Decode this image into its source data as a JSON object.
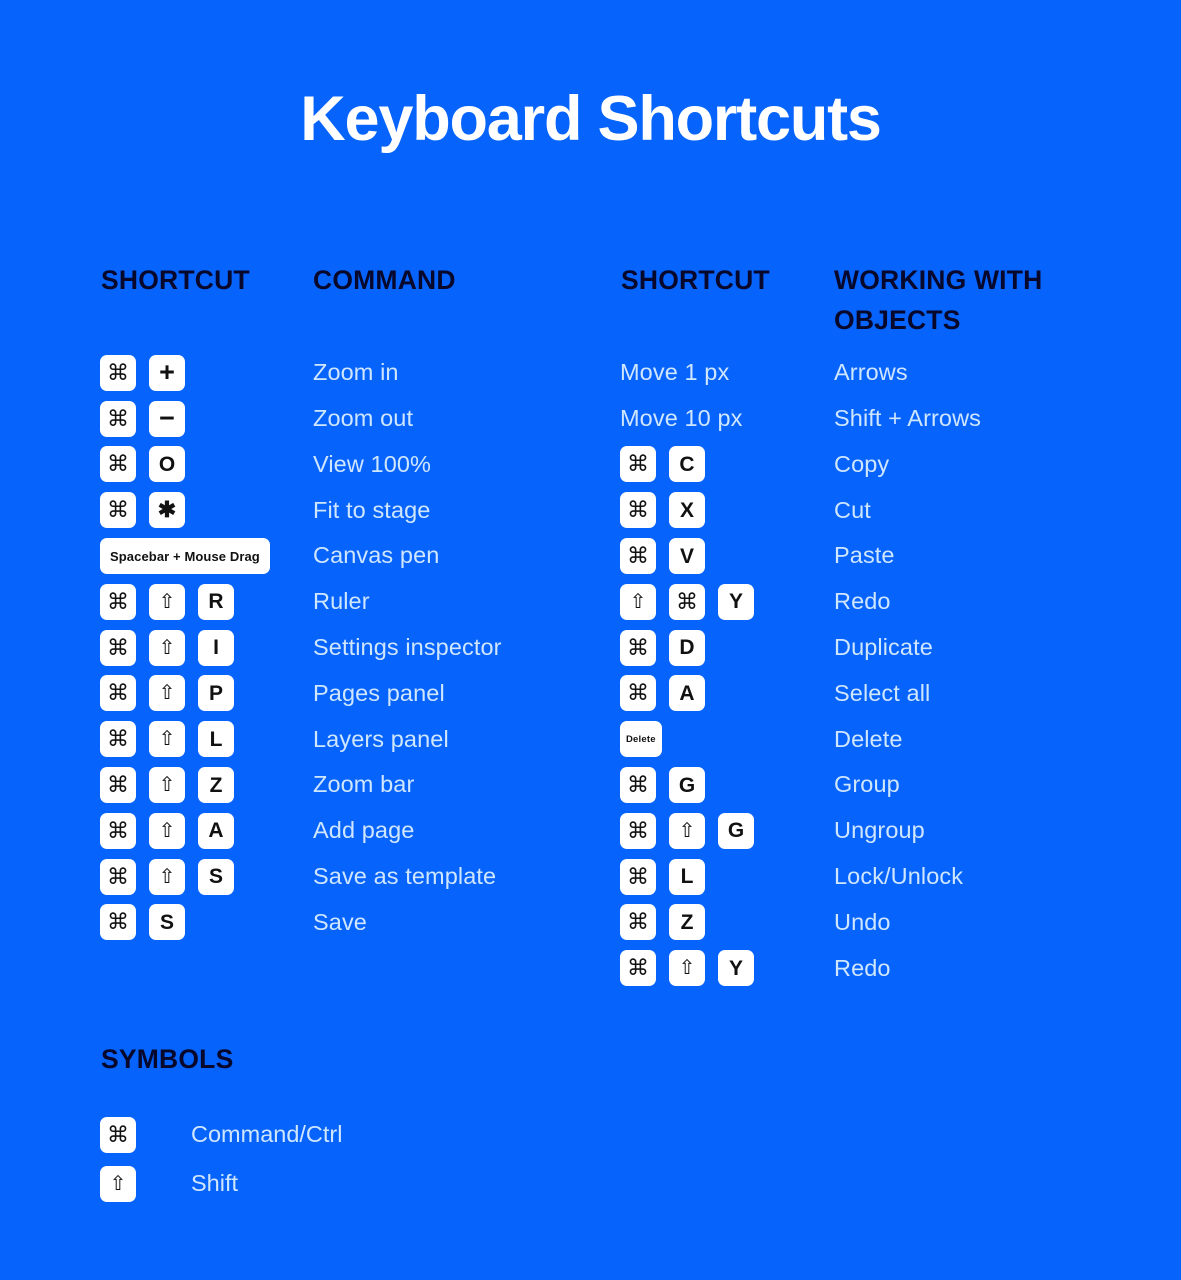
{
  "page": {
    "title": "Keyboard Shortcuts",
    "background_color": "#0663fb",
    "header_color": "#08082c",
    "label_color": "#cfe6ff",
    "key_bg_color": "#ffffff"
  },
  "headers": {
    "shortcut_left": "SHORTCUT",
    "command": "COMMAND",
    "shortcut_right": "SHORTCUT",
    "working_with_objects": "WORKING WITH OBJECTS"
  },
  "commands": [
    {
      "keys": [
        "⌘",
        "+"
      ],
      "label": "Zoom in"
    },
    {
      "keys": [
        "⌘",
        "−"
      ],
      "label": "Zoom out"
    },
    {
      "keys": [
        "⌘",
        "O"
      ],
      "label": "View 100%"
    },
    {
      "keys": [
        "⌘",
        "✱"
      ],
      "label": "Fit to stage"
    },
    {
      "keys": [
        "Spacebar + Mouse Drag"
      ],
      "label": "Canvas pen"
    },
    {
      "keys": [
        "⌘",
        "⇧",
        "R"
      ],
      "label": "Ruler"
    },
    {
      "keys": [
        "⌘",
        "⇧",
        "I"
      ],
      "label": "Settings inspector"
    },
    {
      "keys": [
        "⌘",
        "⇧",
        "P"
      ],
      "label": "Pages panel"
    },
    {
      "keys": [
        "⌘",
        "⇧",
        "L"
      ],
      "label": "Layers panel"
    },
    {
      "keys": [
        "⌘",
        "⇧",
        "Z"
      ],
      "label": "Zoom bar"
    },
    {
      "keys": [
        "⌘",
        "⇧",
        "A"
      ],
      "label": "Add page"
    },
    {
      "keys": [
        "⌘",
        "⇧",
        "S"
      ],
      "label": "Save as template"
    },
    {
      "keys": [
        "⌘",
        "S"
      ],
      "label": "Save"
    }
  ],
  "objects": [
    {
      "text": "Move 1 px",
      "label": "Arrows"
    },
    {
      "text": "Move 10 px",
      "label": "Shift + Arrows"
    },
    {
      "keys": [
        "⌘",
        "C"
      ],
      "label": "Copy"
    },
    {
      "keys": [
        "⌘",
        "X"
      ],
      "label": "Cut"
    },
    {
      "keys": [
        "⌘",
        "V"
      ],
      "label": "Paste"
    },
    {
      "keys": [
        "⇧",
        "⌘",
        "Y"
      ],
      "label": "Redo"
    },
    {
      "keys": [
        "⌘",
        "D"
      ],
      "label": "Duplicate"
    },
    {
      "keys": [
        "⌘",
        "A"
      ],
      "label": "Select all"
    },
    {
      "keys": [
        "Delete"
      ],
      "label": "Delete"
    },
    {
      "keys": [
        "⌘",
        "G"
      ],
      "label": "Group"
    },
    {
      "keys": [
        "⌘",
        "⇧",
        "G"
      ],
      "label": "Ungroup"
    },
    {
      "keys": [
        "⌘",
        "L"
      ],
      "label": "Lock/Unlock"
    },
    {
      "keys": [
        "⌘",
        "Z"
      ],
      "label": "Undo"
    },
    {
      "keys": [
        "⌘",
        "⇧",
        "Y"
      ],
      "label": "Redo"
    }
  ],
  "symbols": {
    "heading": "SYMBOLS",
    "items": [
      {
        "key": "⌘",
        "label": "Command/Ctrl"
      },
      {
        "key": "⇧",
        "label": "Shift"
      }
    ]
  }
}
